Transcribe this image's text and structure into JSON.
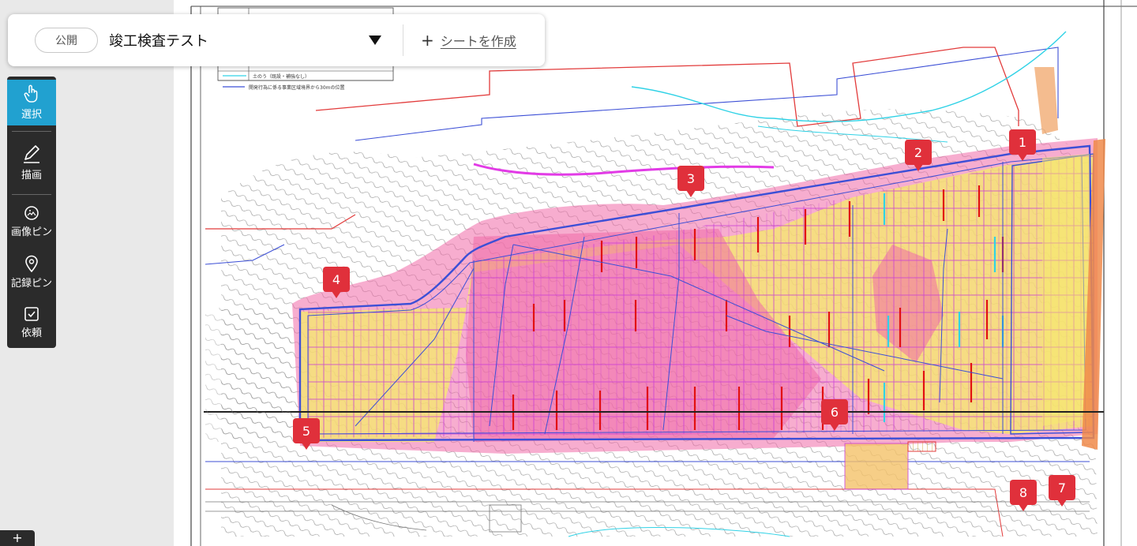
{
  "header": {
    "visibility_label": "公開",
    "sheet_name": "竣工検査テスト",
    "dropdown_icon": "triangle-down-icon",
    "create_sheet_icon": "plus-icon",
    "create_sheet_label": "シートを作成"
  },
  "toolbar": {
    "items": [
      {
        "label": "選択",
        "icon": "pointer-hand-icon",
        "active": true
      },
      {
        "label": "描画",
        "icon": "pencil-icon",
        "active": false
      },
      {
        "label": "画像ピン",
        "icon": "image-pin-icon",
        "active": false
      },
      {
        "label": "記録ピン",
        "icon": "location-pin-icon",
        "active": false
      },
      {
        "label": "依頼",
        "icon": "checkbox-icon",
        "active": false
      }
    ]
  },
  "drawing": {
    "legend_lines": [
      "土のう（既設・補強なし）",
      "開発行為に係る事業区域境界から30mの位置"
    ]
  },
  "pins": [
    "1",
    "2",
    "3",
    "4",
    "5",
    "6",
    "7",
    "8"
  ],
  "colors": {
    "accent": "#21a1d0",
    "toolbar_bg": "#2b2b2b",
    "pin": "#e0303b",
    "pink_zone": "#f06aa8",
    "yellow_zone": "#f5ec6a",
    "red_boundary": "#e23b3b",
    "blue_boundary": "#3c4fd6",
    "cyan_line": "#30d2e6"
  },
  "corner_button_icon": "plus-icon"
}
